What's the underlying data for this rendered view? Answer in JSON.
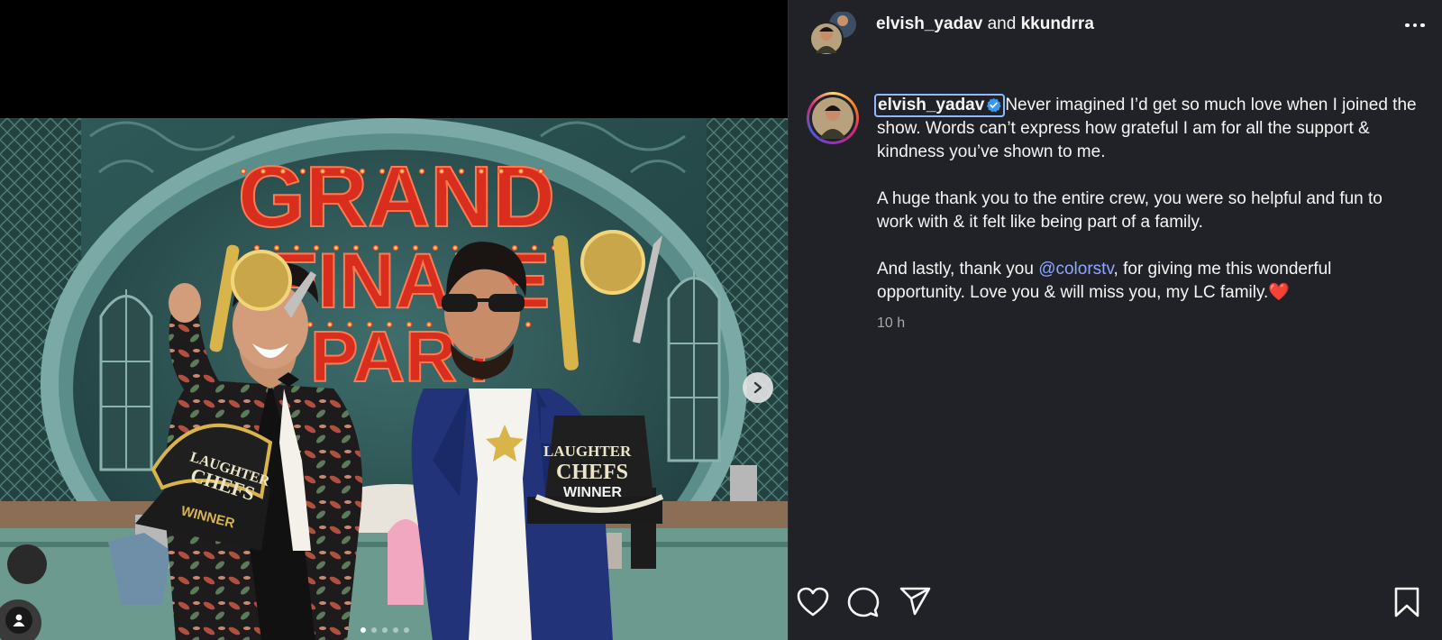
{
  "post": {
    "author": "elvish_yadav",
    "and_text": "and",
    "collaborator": "kkundrra",
    "caption_username": "elvish_yadav",
    "caption_paragraph_1": "Never imagined I’d get so much love when I joined the show. Words can’t express how grateful I am for all the support & kindness you’ve shown to me.",
    "caption_paragraph_2": "A huge thank you to the entire crew, you were so helpful and fun to work with & it felt like being part of a family.",
    "caption_p3_before": "And lastly, thank you ",
    "caption_mention": "@colorstv",
    "caption_p3_after": ", for giving me this wonderful opportunity. Love you & will miss you, my LC family.",
    "caption_emoji": "❤️",
    "timestamp": "10 h"
  },
  "media": {
    "image_sign_text": [
      "GRAND",
      "FINALE",
      "PART"
    ],
    "trophy_label_1": "LAUGHTER",
    "trophy_label_2": "CHEFS",
    "trophy_winner": "WINNER",
    "carousel_count": 5,
    "carousel_active": 1
  },
  "icons": {
    "more": "more-horizontal-icon",
    "next": "chevron-right-icon",
    "user_tag": "user-icon",
    "like": "heart-icon",
    "comment": "comment-icon",
    "share": "paper-plane-icon",
    "save": "bookmark-icon",
    "verified": "verified-badge-icon"
  },
  "colors": {
    "panel_bg": "#212227",
    "mention": "#8fa7ff",
    "verified": "#3897f0",
    "marquee_bulb": "#ff3a2a"
  }
}
